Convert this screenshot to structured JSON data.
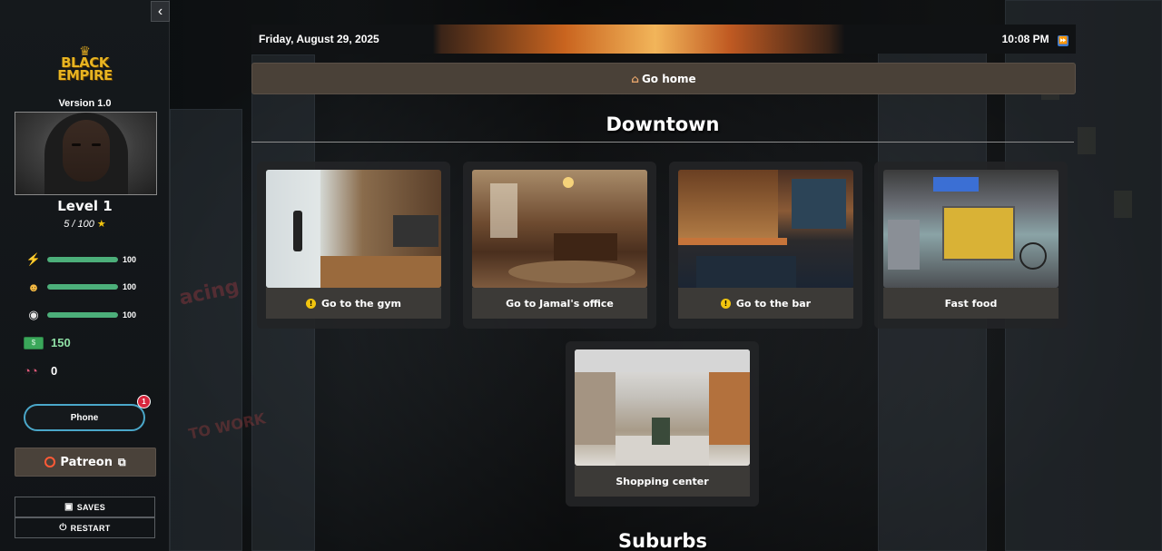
{
  "sidebar": {
    "collapse_icon": "chevron-left-icon",
    "logo_line1": "BLACK",
    "logo_line2": "EMPIRE",
    "version": "Version 1.0",
    "level": "Level 1",
    "xp": "5 / 100",
    "stats": [
      {
        "icon": "lightning-icon",
        "value": "100",
        "percent": 100
      },
      {
        "icon": "smiley-icon",
        "value": "100",
        "percent": 100
      },
      {
        "icon": "plate-icon",
        "value": "100",
        "percent": 100
      }
    ],
    "money": "150",
    "charm": "0",
    "phone_label": "Phone",
    "phone_badge": "1",
    "patreon_label": "Patreon",
    "saves_label": "SAVES",
    "restart_label": "RESTART"
  },
  "topbar": {
    "date": "Friday, August 29, 2025",
    "time": "10:08 PM"
  },
  "go_home_label": "Go home",
  "sections": {
    "downtown": "Downtown",
    "suburbs": "Suburbs"
  },
  "locations": [
    {
      "label": "Go to the gym",
      "warning": true
    },
    {
      "label": "Go to Jamal's office",
      "warning": false
    },
    {
      "label": "Go to the bar",
      "warning": true
    },
    {
      "label": "Fast food",
      "warning": false
    },
    {
      "label": "Shopping center",
      "warning": false
    }
  ],
  "colors": {
    "accent_bar": "#4caf7a",
    "gold": "#e8b421",
    "phone_border": "#4aa7c9",
    "badge": "#d7263d"
  }
}
